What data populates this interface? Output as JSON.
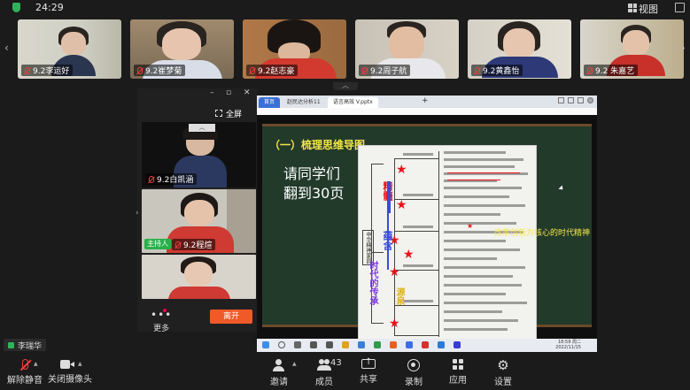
{
  "topbar": {
    "timer": "24:29",
    "view_label": "视图"
  },
  "participants": [
    {
      "name": "9.2李运好"
    },
    {
      "name": "9.2崔梦菊"
    },
    {
      "name": "9.2赵志豪"
    },
    {
      "name": "9.2周子航"
    },
    {
      "name": "9.2黄鑫怡"
    },
    {
      "name": "9.2 朱嘉艺"
    }
  ],
  "side_panel": {
    "fullscreen_label": "全屏",
    "tiles": [
      {
        "name": "9.2白凯涵"
      },
      {
        "name": "9.2程煊",
        "host_tag": "主持人"
      },
      {
        "name": ""
      }
    ],
    "more_label": "更多",
    "leave_label": "离开"
  },
  "shared_screen": {
    "tabs": [
      {
        "label": "首页"
      },
      {
        "label": "赵民达分析11"
      },
      {
        "label": "语言高效 V.pptx"
      }
    ],
    "slide": {
      "title": "（一）梳理思维导图",
      "ask_line1": "请同学们",
      "ask_line2": "翻到30页",
      "vtext_jingsui": "精髓",
      "vtext_yunhan": "蕴含",
      "vtext_shidai": "时代的传承",
      "vtext_yuanquan": "源泉",
      "spirit_label": "改革创新为核心的时代精神",
      "tree_root": "中华精神家园"
    },
    "taskbar_time": "18:59 周二",
    "taskbar_date": "2022/11/15"
  },
  "me": {
    "name": "李瑞华"
  },
  "toolbar": {
    "mute_label": "解除静音",
    "camera_label": "关闭摄像头",
    "invite_label": "邀请",
    "members_label": "成员",
    "members_count": "43",
    "share_label": "共享",
    "record_label": "录制",
    "apps_label": "应用",
    "settings_label": "设置"
  },
  "colors": {
    "background": "#1b1b1b",
    "host_green": "#28b04a",
    "leave_orange": "#f05a28",
    "mute_red": "#f04040",
    "star_red": "#e8131b",
    "slide_yellow": "#f5e64a"
  }
}
